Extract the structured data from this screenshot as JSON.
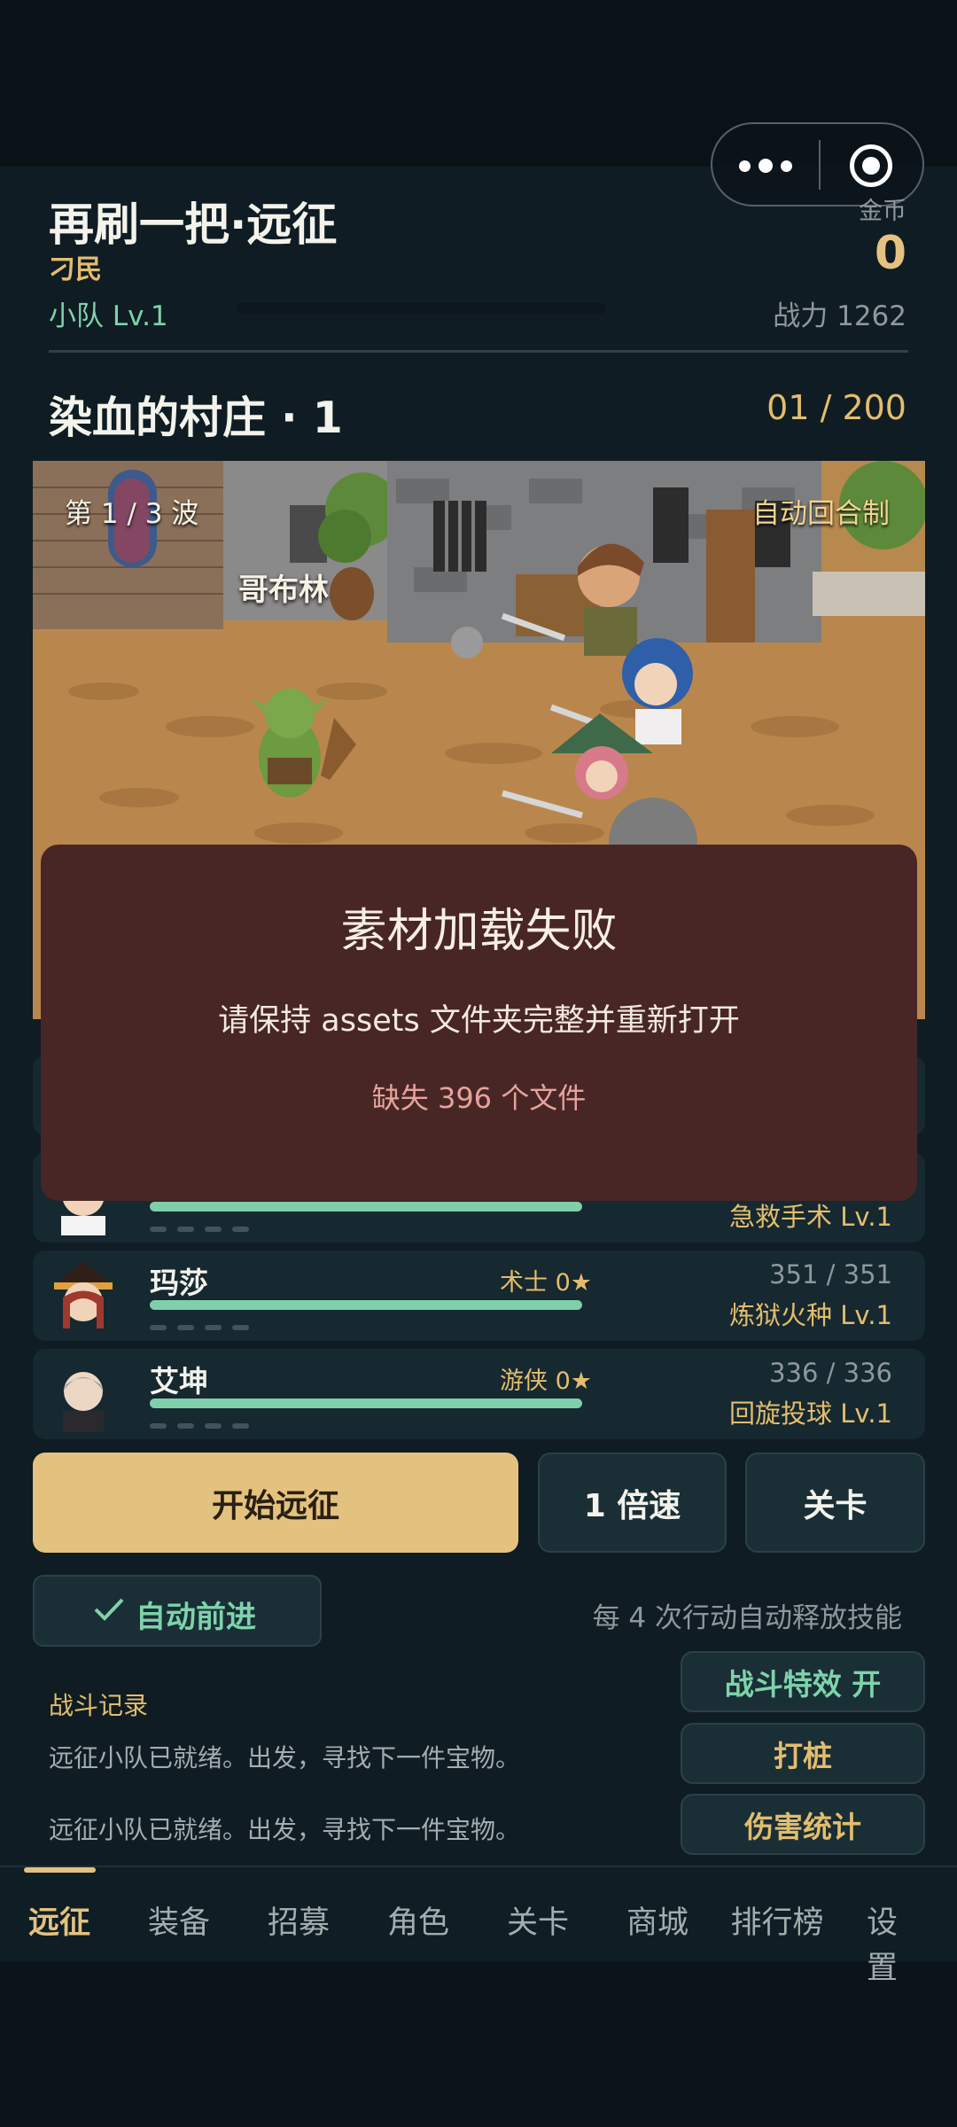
{
  "header": {
    "title": "再刷一把·远征",
    "subtitle": "刁民",
    "team_level": "小队 Lv.1",
    "gold_label": "金币",
    "gold_value": "0",
    "power": "战力 1262"
  },
  "stage": {
    "name": "染血的村庄 · 1",
    "progress": "01 / 200",
    "wave": "第 1 / 3 波",
    "mode": "自动回合制",
    "enemy_name": "哥布林"
  },
  "heroes": [
    {
      "name": "",
      "class": "",
      "hp": "",
      "skill": "急救手术 Lv.1",
      "hp_fraction": 1.0
    },
    {
      "name": "玛莎",
      "class": "术士 0★",
      "hp": "351 / 351",
      "skill": "炼狱火种 Lv.1",
      "hp_fraction": 1.0
    },
    {
      "name": "艾坤",
      "class": "游侠 0★",
      "hp": "336 / 336",
      "skill": "回旋投球 Lv.1",
      "hp_fraction": 1.0
    }
  ],
  "error_modal": {
    "title": "素材加载失败",
    "message": "请保持 assets 文件夹完整并重新打开",
    "missing": "缺失 396 个文件"
  },
  "actions": {
    "start": "开始远征",
    "speed": "1 倍速",
    "stage": "关卡",
    "auto_advance": "自动前进",
    "auto_skill_note": "每 4 次行动自动释放技能",
    "effects_toggle": "战斗特效 开",
    "training_dummy": "打桩",
    "damage_stats": "伤害统计"
  },
  "log": {
    "title": "战斗记录",
    "lines": [
      "远征小队已就绪。出发，寻找下一件宝物。",
      "远征小队已就绪。出发，寻找下一件宝物。"
    ]
  },
  "nav": {
    "items": [
      "远征",
      "装备",
      "招募",
      "角色",
      "关卡",
      "商城",
      "排行榜",
      "设置"
    ],
    "active": "远征"
  },
  "colors": {
    "accent_gold": "#e3c27f",
    "accent_green": "#7ed3aa",
    "error_bg": "#482626",
    "error_text": "#e6a39b"
  },
  "icons": {
    "more": "more-dots-icon",
    "close": "target-circle-icon",
    "check": "check-icon"
  }
}
